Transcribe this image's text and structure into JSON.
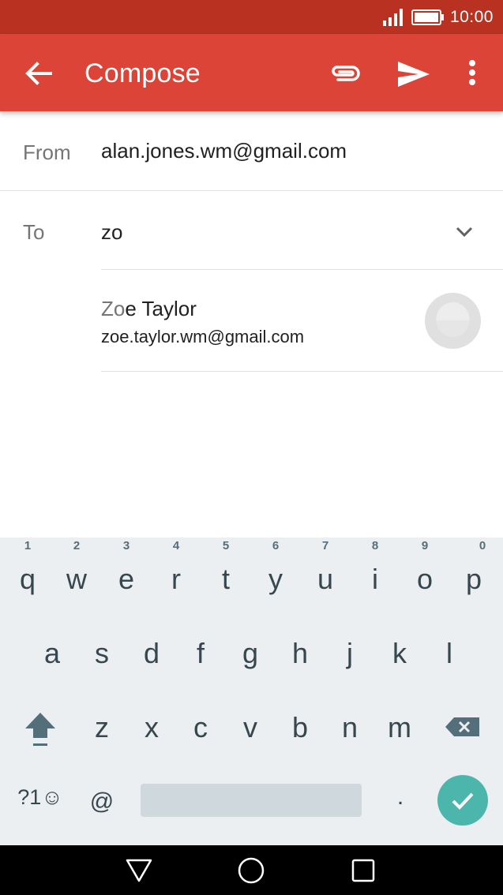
{
  "status_bar": {
    "time": "10:00",
    "signal_icon": "signal-icon",
    "battery_icon": "battery-icon"
  },
  "app_bar": {
    "title": "Compose",
    "back_icon": "arrow-back-icon",
    "attach_icon": "paperclip-icon",
    "send_icon": "send-icon",
    "more_icon": "more-vert-icon",
    "color": "#db4437",
    "status_color": "#b93221"
  },
  "from": {
    "label": "From",
    "value": "alan.jones.wm@gmail.com"
  },
  "to": {
    "label": "To",
    "value": "zo",
    "expand_icon": "chevron-down-icon"
  },
  "suggestion": {
    "name_match": "Zo",
    "name_rest": "e Taylor",
    "email": "zoe.taylor.wm@gmail.com",
    "avatar_icon": "contact-avatar-icon"
  },
  "keyboard": {
    "row1": [
      {
        "key": "q",
        "hint": "1"
      },
      {
        "key": "w",
        "hint": "2"
      },
      {
        "key": "e",
        "hint": "3"
      },
      {
        "key": "r",
        "hint": "4"
      },
      {
        "key": "t",
        "hint": "5"
      },
      {
        "key": "y",
        "hint": "6"
      },
      {
        "key": "u",
        "hint": "7"
      },
      {
        "key": "i",
        "hint": "8"
      },
      {
        "key": "o",
        "hint": "9"
      },
      {
        "key": "p",
        "hint": "0"
      }
    ],
    "row2": [
      "a",
      "s",
      "d",
      "f",
      "g",
      "h",
      "j",
      "k",
      "l"
    ],
    "row3": [
      "z",
      "x",
      "c",
      "v",
      "b",
      "n",
      "m"
    ],
    "symbols_key": "?1☺",
    "at_key": "@",
    "period_key": ".",
    "shift_icon": "shift-icon",
    "backspace_icon": "backspace-icon",
    "enter_icon": "check-icon",
    "accent": "#4db6ac"
  },
  "nav_bar": {
    "back_icon": "nav-back-icon",
    "home_icon": "nav-home-icon",
    "recents_icon": "nav-recents-icon"
  }
}
